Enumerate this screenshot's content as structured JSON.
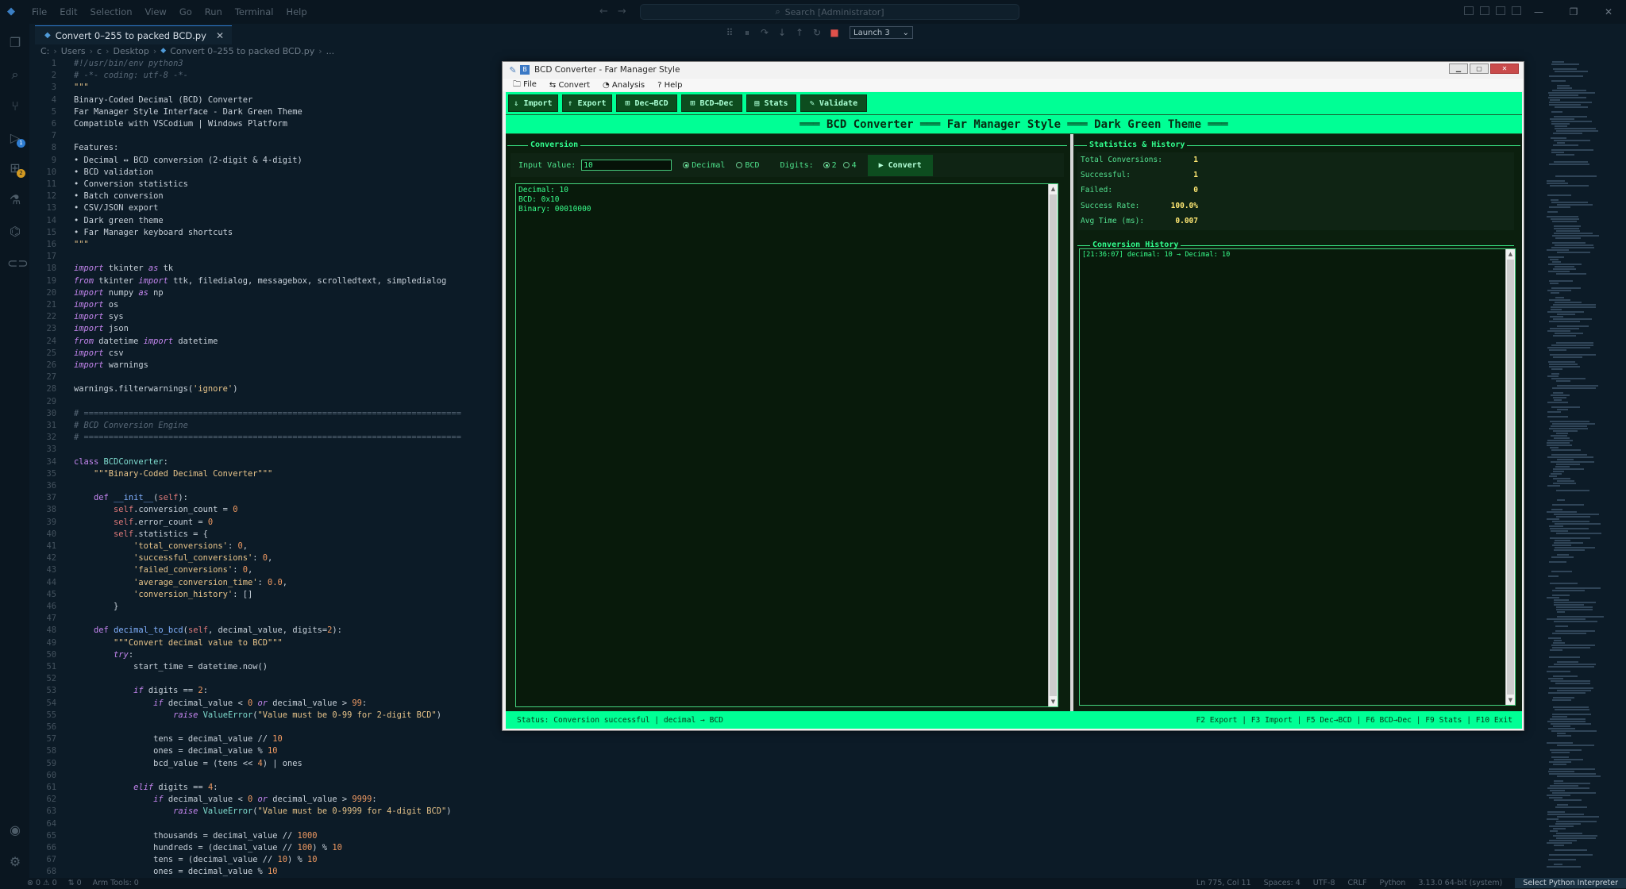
{
  "vscode": {
    "menu": [
      "File",
      "Edit",
      "Selection",
      "View",
      "Go",
      "Run",
      "Terminal",
      "Help"
    ],
    "search_placeholder": "Search [Administrator]",
    "launch_config": "Launch 3",
    "tab_title": "Convert 0–255 to packed BCD.py",
    "breadcrumb": [
      "C:",
      "Users",
      "c",
      "Desktop",
      "Convert 0–255 to packed BCD.py",
      "..."
    ],
    "status_left": [
      "⊗ 0 ⚠ 0",
      "⇅ 0",
      "Arm Tools: 0"
    ],
    "status_right": [
      "Ln 775, Col 11",
      "Spaces: 4",
      "UTF-8",
      "CRLF",
      "Python",
      "3.13.0 64-bit (system)",
      "Select Python Interpreter"
    ]
  },
  "code": [
    {
      "n": "1",
      "t": "#!/usr/bin/env python3"
    },
    {
      "n": "2",
      "t": "# -*- coding: utf-8 -*-"
    },
    {
      "n": "3",
      "t": "\"\"\""
    },
    {
      "n": "4",
      "t": "Binary-Coded Decimal (BCD) Converter"
    },
    {
      "n": "5",
      "t": "Far Manager Style Interface - Dark Green Theme"
    },
    {
      "n": "6",
      "t": "Compatible with VSCodium | Windows Platform"
    },
    {
      "n": "7",
      "t": ""
    },
    {
      "n": "8",
      "t": "Features:"
    },
    {
      "n": "9",
      "t": "• Decimal ↔ BCD conversion (2-digit & 4-digit)"
    },
    {
      "n": "10",
      "t": "• BCD validation"
    },
    {
      "n": "11",
      "t": "• Conversion statistics"
    },
    {
      "n": "12",
      "t": "• Batch conversion"
    },
    {
      "n": "13",
      "t": "• CSV/JSON export"
    },
    {
      "n": "14",
      "t": "• Dark green theme"
    },
    {
      "n": "15",
      "t": "• Far Manager keyboard shortcuts"
    },
    {
      "n": "16",
      "t": "\"\"\""
    },
    {
      "n": "17",
      "t": ""
    },
    {
      "n": "18",
      "t": "import tkinter as tk"
    },
    {
      "n": "19",
      "t": "from tkinter import ttk, filedialog, messagebox, scrolledtext, simpledialog"
    },
    {
      "n": "20",
      "t": "import numpy as np"
    },
    {
      "n": "21",
      "t": "import os"
    },
    {
      "n": "22",
      "t": "import sys"
    },
    {
      "n": "23",
      "t": "import json"
    },
    {
      "n": "24",
      "t": "from datetime import datetime"
    },
    {
      "n": "25",
      "t": "import csv"
    },
    {
      "n": "26",
      "t": "import warnings"
    },
    {
      "n": "27",
      "t": ""
    },
    {
      "n": "28",
      "t": "warnings.filterwarnings('ignore')"
    },
    {
      "n": "29",
      "t": ""
    },
    {
      "n": "30",
      "t": "# ============================================================================"
    },
    {
      "n": "31",
      "t": "# BCD Conversion Engine"
    },
    {
      "n": "32",
      "t": "# ============================================================================"
    },
    {
      "n": "33",
      "t": ""
    },
    {
      "n": "34",
      "t": "class BCDConverter:"
    },
    {
      "n": "35",
      "t": "    \"\"\"Binary-Coded Decimal Converter\"\"\""
    },
    {
      "n": "36",
      "t": ""
    },
    {
      "n": "37",
      "t": "    def __init__(self):"
    },
    {
      "n": "38",
      "t": "        self.conversion_count = 0"
    },
    {
      "n": "39",
      "t": "        self.error_count = 0"
    },
    {
      "n": "40",
      "t": "        self.statistics = {"
    },
    {
      "n": "41",
      "t": "            'total_conversions': 0,"
    },
    {
      "n": "42",
      "t": "            'successful_conversions': 0,"
    },
    {
      "n": "43",
      "t": "            'failed_conversions': 0,"
    },
    {
      "n": "44",
      "t": "            'average_conversion_time': 0.0,"
    },
    {
      "n": "45",
      "t": "            'conversion_history': []"
    },
    {
      "n": "46",
      "t": "        }"
    },
    {
      "n": "47",
      "t": ""
    },
    {
      "n": "48",
      "t": "    def decimal_to_bcd(self, decimal_value, digits=2):"
    },
    {
      "n": "49",
      "t": "        \"\"\"Convert decimal value to BCD\"\"\""
    },
    {
      "n": "50",
      "t": "        try:"
    },
    {
      "n": "51",
      "t": "            start_time = datetime.now()"
    },
    {
      "n": "52",
      "t": ""
    },
    {
      "n": "53",
      "t": "            if digits == 2:"
    },
    {
      "n": "54",
      "t": "                if decimal_value < 0 or decimal_value > 99:"
    },
    {
      "n": "55",
      "t": "                    raise ValueError(\"Value must be 0-99 for 2-digit BCD\")"
    },
    {
      "n": "56",
      "t": ""
    },
    {
      "n": "57",
      "t": "                tens = decimal_value // 10"
    },
    {
      "n": "58",
      "t": "                ones = decimal_value % 10"
    },
    {
      "n": "59",
      "t": "                bcd_value = (tens << 4) | ones"
    },
    {
      "n": "60",
      "t": ""
    },
    {
      "n": "61",
      "t": "            elif digits == 4:"
    },
    {
      "n": "62",
      "t": "                if decimal_value < 0 or decimal_value > 9999:"
    },
    {
      "n": "63",
      "t": "                    raise ValueError(\"Value must be 0-9999 for 4-digit BCD\")"
    },
    {
      "n": "64",
      "t": ""
    },
    {
      "n": "65",
      "t": "                thousands = decimal_value // 1000"
    },
    {
      "n": "66",
      "t": "                hundreds = (decimal_value // 100) % 10"
    },
    {
      "n": "67",
      "t": "                tens = (decimal_value // 10) % 10"
    },
    {
      "n": "68",
      "t": "                ones = decimal_value % 10"
    }
  ],
  "app": {
    "window_title": "BCD Converter - Far Manager Style",
    "menu": [
      "🗀 File",
      "⇆ Convert",
      "◔ Analysis",
      "? Help"
    ],
    "toolbar": [
      "⇓ Import",
      "⇑ Export",
      "⊞ Dec→BCD",
      "⊞ BCD→Dec",
      "▤ Stats",
      "✎ Validate"
    ],
    "header": "═══ BCD Converter ═══ Far Manager Style ═══ Dark Green Theme ═══",
    "conversion_title": "Conversion",
    "input_label": "Input Value:",
    "input_value": "10",
    "mode_options": [
      "Decimal",
      "BCD"
    ],
    "mode_selected": "Decimal",
    "digits_label": "Digits:",
    "digit_options": [
      "2",
      "4"
    ],
    "digits_selected": "2",
    "convert_button": "▶ Convert",
    "output_text": "Decimal: 10\nBCD: 0x10\nBinary: 00010000",
    "stats_title": "Statistics & History",
    "stats": [
      {
        "label": "Total Conversions:",
        "value": "1"
      },
      {
        "label": "Successful:",
        "value": "1"
      },
      {
        "label": "Failed:",
        "value": "0"
      },
      {
        "label": "Success Rate:",
        "value": "100.0%"
      },
      {
        "label": "Avg Time (ms):",
        "value": "0.007"
      }
    ],
    "history_title": "Conversion History",
    "history": "[21:36:07] decimal: 10 → Decimal: 10",
    "status_left": "Status: Conversion successful | decimal → BCD",
    "status_right": "F2 Export | F3 Import | F5 Dec→BCD | F6 BCD→Dec | F9 Stats | F10 Exit"
  }
}
